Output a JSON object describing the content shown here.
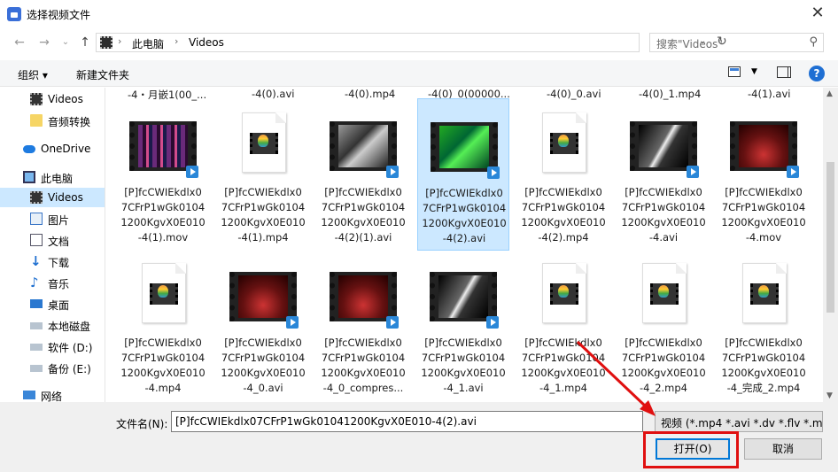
{
  "window": {
    "title": "选择视频文件",
    "close": "✕"
  },
  "nav": {
    "back": "←",
    "forward": "→",
    "recent": "⌄",
    "up": "↑"
  },
  "address": {
    "crumbs": [
      "此电脑",
      "Videos"
    ]
  },
  "search": {
    "placeholder": "搜索\"Videos\""
  },
  "toolbar": {
    "organize": "组织 ▾",
    "new_folder": "新建文件夹",
    "help": "?"
  },
  "sidebar": {
    "items": [
      {
        "label": "Videos",
        "icon": "video-folder-icon"
      },
      {
        "label": "音频转换",
        "icon": "folder-icon"
      },
      {
        "label": "OneDrive",
        "icon": "cloud-icon"
      },
      {
        "label": "此电脑",
        "icon": "computer-icon"
      },
      {
        "label": "Videos",
        "icon": "video-folder-icon",
        "selected": true
      },
      {
        "label": "图片",
        "icon": "pictures-icon"
      },
      {
        "label": "文档",
        "icon": "documents-icon"
      },
      {
        "label": "下载",
        "icon": "download-icon"
      },
      {
        "label": "音乐",
        "icon": "music-icon"
      },
      {
        "label": "桌面",
        "icon": "desktop-icon"
      },
      {
        "label": "本地磁盘",
        "icon": "drive-icon"
      },
      {
        "label": "软件 (D:)",
        "icon": "drive-icon"
      },
      {
        "label": "备份 (E:)",
        "icon": "drive-icon"
      },
      {
        "label": "网络",
        "icon": "network-icon"
      }
    ]
  },
  "partial_row": [
    "-4・月嵌1(00_...",
    "-4(0).avi",
    "-4(0).mp4",
    "-4(0)_0(00000...",
    "-4(0)_0.avi",
    "-4(0)_1.mp4",
    "-4(1).avi",
    "-4(1).mp4"
  ],
  "files_row1": [
    {
      "l1": "[P]fcCWIEkdlx0",
      "l2": "7CFrP1wGk0104",
      "l3": "1200KgvX0E010",
      "l4": "-4(1).mov",
      "kind": "noise"
    },
    {
      "l1": "[P]fcCWIEkdlx0",
      "l2": "7CFrP1wGk0104",
      "l3": "1200KgvX0E010",
      "l4": "-4(1).mp4",
      "kind": "doc"
    },
    {
      "l1": "[P]fcCWIEkdlx0",
      "l2": "7CFrP1wGk0104",
      "l3": "1200KgvX0E010",
      "l4": "-4(2)(1).avi",
      "kind": "holdon"
    },
    {
      "l1": "[P]fcCWIEkdlx0",
      "l2": "7CFrP1wGk0104",
      "l3": "1200KgvX0E010",
      "l4": "-4(2).avi",
      "kind": "holdon-green",
      "selected": true
    },
    {
      "l1": "[P]fcCWIEkdlx0",
      "l2": "7CFrP1wGk0104",
      "l3": "1200KgvX0E010",
      "l4": "-4(2).mp4",
      "kind": "doc"
    },
    {
      "l1": "[P]fcCWIEkdlx0",
      "l2": "7CFrP1wGk0104",
      "l3": "1200KgvX0E010",
      "l4": "-4.avi",
      "kind": "smile"
    },
    {
      "l1": "[P]fcCWIEkdlx0",
      "l2": "7CFrP1wGk0104",
      "l3": "1200KgvX0E010",
      "l4": "-4.mov",
      "kind": "stage"
    }
  ],
  "files_row2": [
    {
      "l1": "[P]fcCWIEkdlx0",
      "l2": "7CFrP1wGk0104",
      "l3": "1200KgvX0E010",
      "l4": "-4.mp4",
      "kind": "doc"
    },
    {
      "l1": "[P]fcCWIEkdlx0",
      "l2": "7CFrP1wGk0104",
      "l3": "1200KgvX0E010",
      "l4": "-4_0.avi",
      "kind": "stage"
    },
    {
      "l1": "[P]fcCWIEkdlx0",
      "l2": "7CFrP1wGk0104",
      "l3": "1200KgvX0E010",
      "l4": "-4_0_compres...",
      "kind": "stage"
    },
    {
      "l1": "[P]fcCWIEkdlx0",
      "l2": "7CFrP1wGk0104",
      "l3": "1200KgvX0E010",
      "l4": "-4_1.avi",
      "kind": "smile"
    },
    {
      "l1": "[P]fcCWIEkdlx0",
      "l2": "7CFrP1wGk0104",
      "l3": "1200KgvX0E010",
      "l4": "-4_1.mp4",
      "kind": "doc"
    },
    {
      "l1": "[P]fcCWIEkdlx0",
      "l2": "7CFrP1wGk0104",
      "l3": "1200KgvX0E010",
      "l4": "-4_2.mp4",
      "kind": "doc"
    },
    {
      "l1": "[P]fcCWIEkdlx0",
      "l2": "7CFrP1wGk0104",
      "l3": "1200KgvX0E010",
      "l4": "-4_完成_2.mp4",
      "kind": "doc"
    }
  ],
  "footer": {
    "filename_label": "文件名(N):",
    "filename_value": "[P]fcCWIEkdlx07CFrP1wGk01041200KgvX0E010-4(2).avi",
    "filetype_value": "视频 (*.mp4 *.avi *.dv *.flv *.m",
    "open_label": "打开(O)",
    "cancel_label": "取消"
  },
  "colors": {
    "selection": "#cce8ff",
    "accent": "#0078d7",
    "highlight": "#e01010"
  }
}
